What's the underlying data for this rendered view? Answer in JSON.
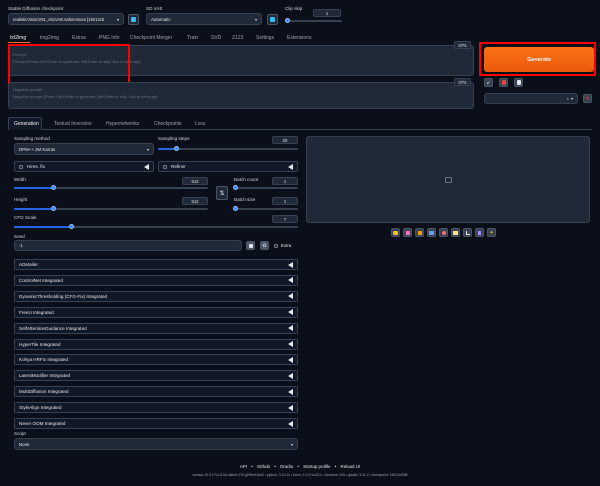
{
  "header": {
    "checkpoint_label": "Stable Diffusion checkpoint",
    "checkpoint_value": "realisticVisionV51_v51VAE.safetensors [15012c5",
    "vae_label": "SD VAE",
    "vae_value": "Automatic",
    "clip_skip_label": "Clip skip",
    "clip_skip_value": "1"
  },
  "main_tabs": [
    "txt2img",
    "img2img",
    "Extras",
    "PNG Info",
    "Checkpoint Merger",
    "Train",
    "SVD",
    "Z123",
    "Settings",
    "Extensions"
  ],
  "prompt": {
    "label": "Prompt",
    "placeholder": "Prompt (Press Ctrl+Enter to generate, Alt+Enter to skip, Esc to interrupt)",
    "token_count": "0/75"
  },
  "negative_prompt": {
    "label": "Negative prompt",
    "placeholder": "Negative prompt (Press Ctrl+Enter to generate, Alt+Enter to skip, Esc to interrupt)",
    "token_count": "0/75"
  },
  "generate_label": "Generate",
  "sub_tabs": [
    "Generation",
    "Textual Inversion",
    "Hypernetworks",
    "Checkpoints",
    "Lora"
  ],
  "sampling_method": {
    "label": "Sampling method",
    "value": "DPM++ 2M Karras"
  },
  "sampling_steps": {
    "label": "Sampling steps",
    "value": "20",
    "fraction": 0.13
  },
  "hires_label": "Hires. fix",
  "refiner_label": "Refiner",
  "width": {
    "label": "Width",
    "value": "512",
    "fraction": 0.2
  },
  "height": {
    "label": "Height",
    "value": "512",
    "fraction": 0.2
  },
  "batch_count": {
    "label": "Batch count",
    "value": "1",
    "fraction": 0.0
  },
  "batch_size": {
    "label": "Batch size",
    "value": "1",
    "fraction": 0.0
  },
  "cfg_scale": {
    "label": "CFG Scale",
    "value": "7",
    "fraction": 0.2
  },
  "seed": {
    "label": "Seed",
    "value": "-1",
    "extra_label": "Extra"
  },
  "accordions": [
    "ADetailer",
    "ControlNet Integrated",
    "DynamicThresholding (CFG-Fix) Integrated",
    "FreeU Integrated",
    "SelfAttentionGuidance Integrated",
    "HyperTile Integrated",
    "Kohya HRFix Integrated",
    "LatentModifier Integrated",
    "MultiDiffusion Integrated",
    "StyleAlign Integrated",
    "Never OOM Integrated"
  ],
  "script": {
    "label": "Script",
    "value": "None"
  },
  "footer": {
    "links": [
      "API",
      "Github",
      "Gradio",
      "Startup profile",
      "Reload UI"
    ],
    "separator": "•",
    "version_text": "version: f0.0.17v1.8.0rc-latest-276-g29be61bd4  •  python: 3.10.11  •  torch: 2.1.2+cu121  •  xformers: N/A  •  gradio: 3.41.2  •  checkpoint: 15012c538f"
  },
  "colors": {
    "background": "#0b0f19",
    "generate": "#f97316",
    "highlight_box": "#ff0000",
    "slider": "#3b82f6"
  }
}
